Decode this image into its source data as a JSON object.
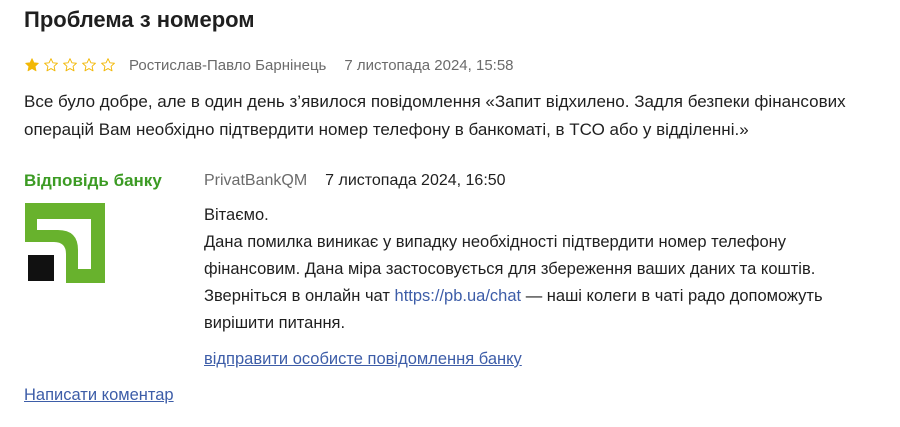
{
  "review": {
    "title": "Проблема з номером",
    "rating": 1,
    "max_rating": 5,
    "star_color_filled": "#f2b807",
    "star_color_empty": "#f2b807",
    "author": "Ростислав-Павло Барнінець",
    "date": "7 листопада 2024, 15:58",
    "text": "Все було добре, але в один день з’явилося повідомлення «Запит відхилено. Задля безпеки фінансових операцій Вам необхідно підтвердити номер телефону в банкоматі, в ТСО або у відділенні.»"
  },
  "answer": {
    "label": "Відповідь банку",
    "label_color": "#3c9b24",
    "bank_name": "PrivatBankQM",
    "date": "7 листопада 2024, 16:50",
    "logo_colors": {
      "green": "#68b22d",
      "black": "#111111"
    },
    "line1": "Вітаємо.",
    "line2": "Дана помилка виникає у випадку необхідності підтвердити номер телефону фінансовим. Дана міра застосовується для збереження ваших даних та коштів.",
    "line3_before": "Зверніться в онлайн чат ",
    "line3_link": "https://pb.ua/chat",
    "line3_after": " — наші колеги в чаті радо допоможуть вирішити питання.",
    "private_message_link": "відправити особисте повідомлення банку"
  },
  "actions": {
    "write_comment": "Написати коментар"
  },
  "colors": {
    "link": "#3d5da8",
    "muted": "#6b6b6b",
    "text": "#1f1f1f"
  }
}
